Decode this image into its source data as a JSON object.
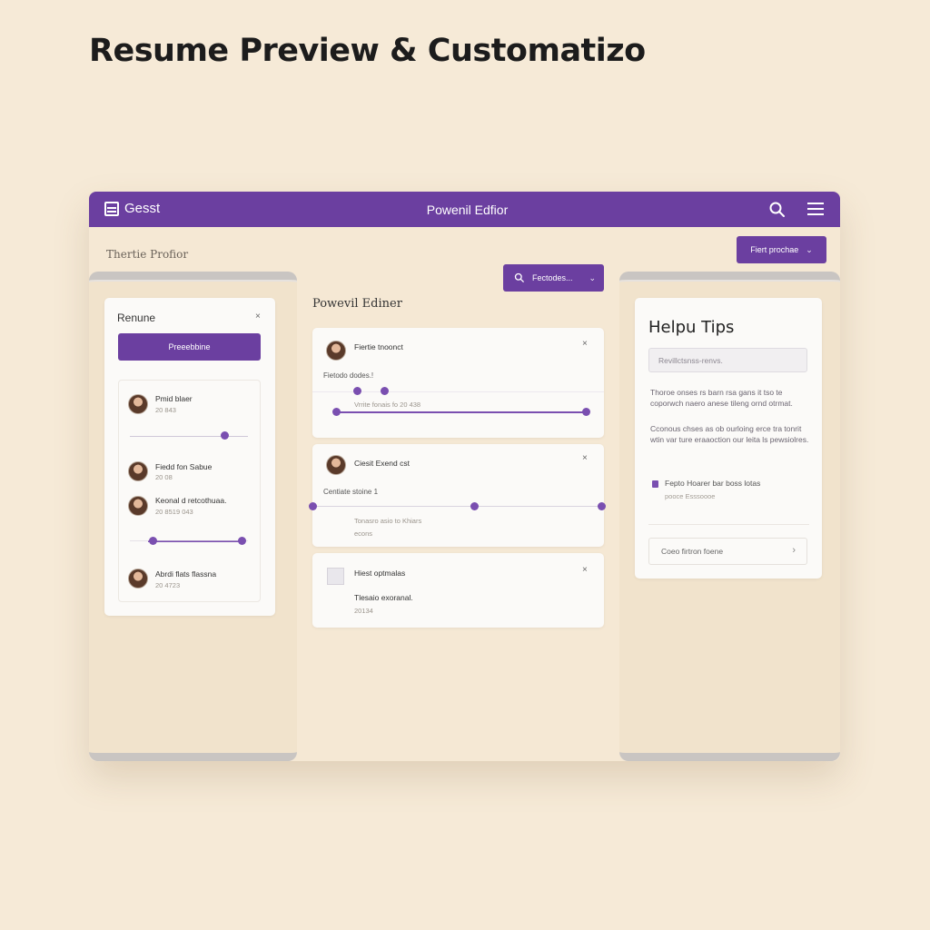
{
  "page": {
    "heading": "Resume Preview & Customatizo"
  },
  "app": {
    "brand": "Gesst",
    "title": "Powenil Edfior",
    "section_label": "Thertie Profior",
    "top_button": "Fiert prochae",
    "search_button": "Fectodes..."
  },
  "left_panel": {
    "title": "Renune",
    "button": "Preeebbine",
    "entries": [
      {
        "name": "Pmid blaer",
        "sub": "20 843"
      },
      {
        "name": "Fiedd fon Sabue",
        "sub": "20 08"
      },
      {
        "name": "Keonal d retcothuaa.",
        "sub": "20 8519 043"
      },
      {
        "name": "Abrdi flats flassna",
        "sub": "20 4723"
      }
    ]
  },
  "editor": {
    "heading": "Powevil Ediner",
    "cards": [
      {
        "title": "Fiertie tnoonct",
        "label": "Fietodo dodes.!",
        "sub": "Vrrite fonais fo 20 438"
      },
      {
        "title": "Ciesit Exend cst",
        "label": "Centiate stoine 1",
        "sub": "Tonasro asio to Khiars",
        "sub2": "econs"
      },
      {
        "title": "Hiest optmalas",
        "label": "Tlesaio exoranal.",
        "sub": "20134"
      }
    ]
  },
  "tips": {
    "title": "Helpu Tips",
    "input_placeholder": "Revillctsnss-renvs.",
    "paragraph1": "Thoroe onses rs barn rsa gans it tso te coporwch naero anese tileng ornd otrmat.",
    "paragraph2": "Cconous chses as ob ourloing erce tra tonrit wtin var ture eraaoction our leita ls pewsiolres.",
    "link": "Fepto Hoarer bar boss lotas",
    "link_sub": "pooce Esssoooe",
    "footer": "Coeo firtron foene"
  },
  "colors": {
    "accent": "#6b3fa0",
    "background": "#f6ead7"
  },
  "icons": {
    "brand": "document-icon",
    "search": "search-icon",
    "menu": "hamburger-menu-icon"
  }
}
